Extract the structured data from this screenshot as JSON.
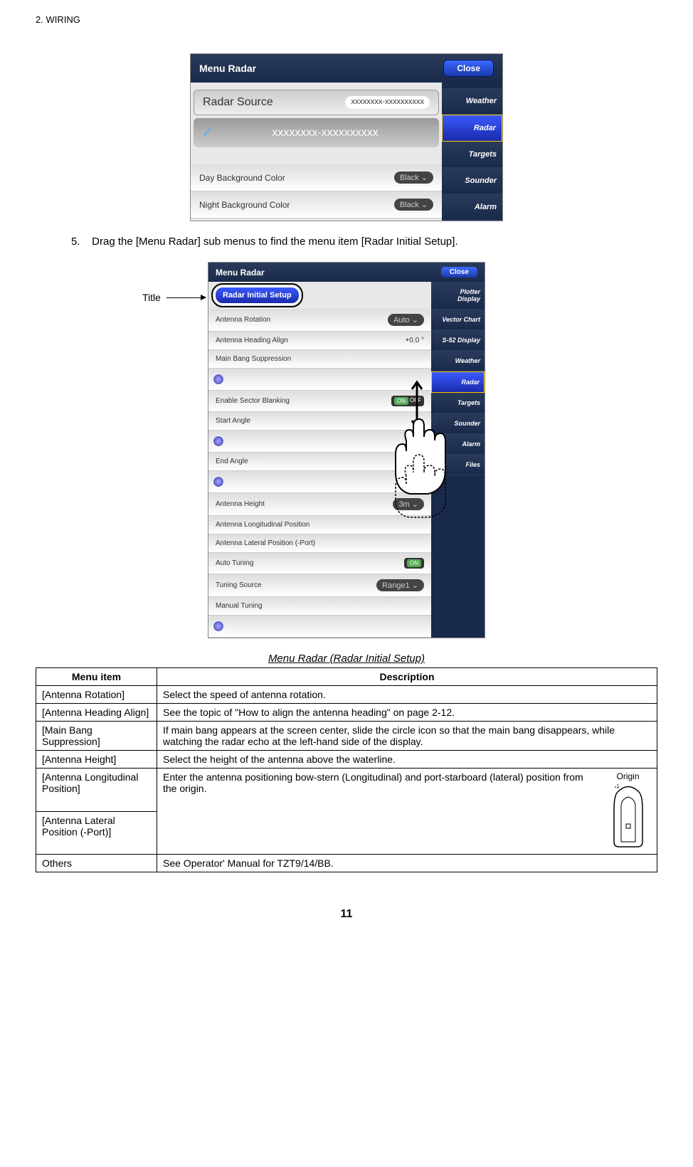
{
  "header": "2.  WIRING",
  "figure1": {
    "title": "Menu Radar",
    "close": "Close",
    "rows": {
      "radar_source": {
        "label": "Radar Source",
        "value": "xxxxxxxx-xxxxxxxxxx"
      },
      "checked_value": "xxxxxxxx-xxxxxxxxxx",
      "day_bg": {
        "label": "Day Background Color",
        "value": "Black"
      },
      "night_bg": {
        "label": "Night Background Color",
        "value": "Black"
      }
    },
    "tabs": [
      "Weather",
      "Radar",
      "Targets",
      "Sounder",
      "Alarm"
    ]
  },
  "step5": {
    "num": "5.",
    "text": "Drag the [Menu Radar] sub menus to find the menu item [Radar Initial Setup]."
  },
  "title_label": "Title",
  "figure2": {
    "title": "Menu Radar",
    "close": "Close",
    "setup_title": "Radar Initial Setup",
    "rows": {
      "antenna_rotation": {
        "label": "Antenna Rotation",
        "value": "Auto"
      },
      "heading_align": {
        "label": "Antenna Heading Align",
        "value": "+0.0 °"
      },
      "main_bang": {
        "label": "Main Bang Suppression"
      },
      "sector_blank": {
        "label": "Enable Sector Blanking",
        "on": "ON",
        "off": "OFF"
      },
      "start_angle": {
        "label": "Start Angle"
      },
      "end_angle": {
        "label": "End Angle"
      },
      "antenna_height": {
        "label": "Antenna Height",
        "value": "3m"
      },
      "long_pos": {
        "label": "Antenna Longitudinal Position"
      },
      "lat_pos": {
        "label": "Antenna Lateral Position (-Port)"
      },
      "auto_tuning": {
        "label": "Auto Tuning",
        "on": "ON"
      },
      "tuning_source": {
        "label": "Tuning Source",
        "value": "Range1"
      },
      "manual_tuning": {
        "label": "Manual Tuning"
      }
    },
    "tabs": [
      "Plotter Display",
      "Vector Chart",
      "S-52 Display",
      "Weather",
      "Radar",
      "Targets",
      "Sounder",
      "Alarm",
      "Files"
    ]
  },
  "table_caption": "Menu Radar (Radar Initial Setup)",
  "table": {
    "header_menu": "Menu item",
    "header_desc": "Description",
    "rows": [
      {
        "item": "[Antenna Rotation]",
        "desc": "Select the speed of antenna rotation."
      },
      {
        "item": "[Antenna Heading Align]",
        "desc": "See the topic of \"How to align the antenna heading\" on page 2-12."
      },
      {
        "item": "[Main Bang Suppression]",
        "desc": "If main bang appears at the screen center, slide the circle icon so that the main bang disappears, while watching the radar echo at the left-hand side of the display."
      },
      {
        "item": "[Antenna Height]",
        "desc": "Select the height of the antenna above the waterline."
      },
      {
        "item": "[Antenna Longitudinal Position]",
        "desc_combined": "Enter the antenna positioning bow-stern (Longitudinal) and port-starboard (lateral) position from the origin.",
        "origin_label": "Origin"
      },
      {
        "item": "[Antenna Lateral Position (-Port)]"
      },
      {
        "item": "Others",
        "desc": "See Operator' Manual for TZT9/14/BB."
      }
    ]
  },
  "page_number": "11"
}
